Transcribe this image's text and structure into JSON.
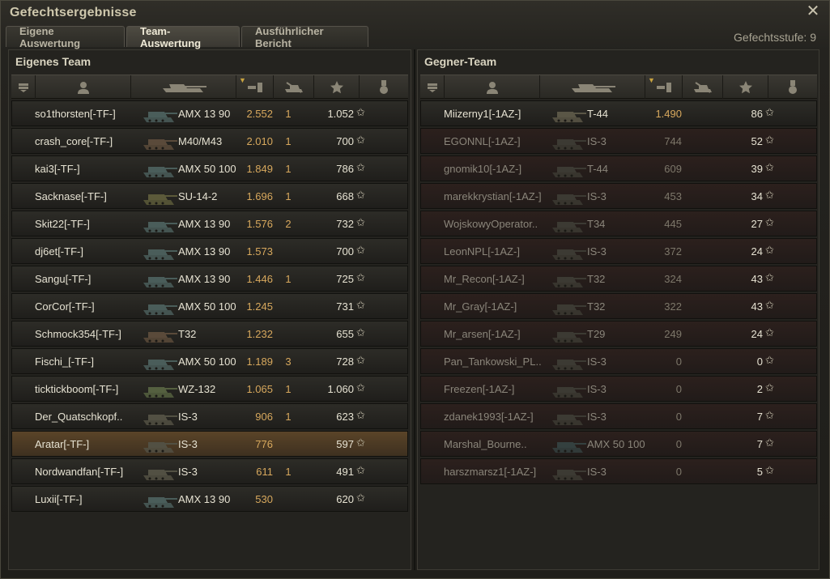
{
  "window": {
    "title": "Gefechtsergebnisse",
    "close_icon": "close-icon"
  },
  "tabs": [
    {
      "label": "Eigene Auswertung",
      "active": false
    },
    {
      "label": "Team-Auswertung",
      "active": true
    },
    {
      "label": "Ausführlicher Bericht",
      "active": false
    }
  ],
  "battle_tier": "Gefechtsstufe: 9",
  "colors": {
    "accent_orange": "#d7a85d",
    "dead_row": "#2c201d",
    "highlight_row": "#5a4428"
  },
  "columns": {
    "icons": [
      "squad-icon",
      "player-icon",
      "tank-icon",
      "damage-icon",
      "kills-icon",
      "xp-icon",
      "medal-icon"
    ],
    "sorted_by": "damage"
  },
  "own_team": {
    "title": "Eigenes Team",
    "players": [
      {
        "name": "so1thorsten[-TF-]",
        "vehicle": "AMX 13 90",
        "damage": "2.552",
        "kills": "1",
        "xp": "1.052",
        "tank_color": "#4a5d5a",
        "dead": false
      },
      {
        "name": "crash_core[-TF-]",
        "vehicle": "M40/M43",
        "damage": "2.010",
        "kills": "1",
        "xp": "700",
        "tank_color": "#5a4a3a",
        "dead": false
      },
      {
        "name": "kai3[-TF-]",
        "vehicle": "AMX 50 100",
        "damage": "1.849",
        "kills": "1",
        "xp": "786",
        "tank_color": "#4a5d5a",
        "dead": false
      },
      {
        "name": "Sacknase[-TF-]",
        "vehicle": "SU-14-2",
        "damage": "1.696",
        "kills": "1",
        "xp": "668",
        "tank_color": "#5c5a3a",
        "dead": false
      },
      {
        "name": "Skit22[-TF-]",
        "vehicle": "AMX 13 90",
        "damage": "1.576",
        "kills": "2",
        "xp": "732",
        "tank_color": "#4a5d5a",
        "dead": false
      },
      {
        "name": "dj6et[-TF-]",
        "vehicle": "AMX 13 90",
        "damage": "1.573",
        "kills": "",
        "xp": "700",
        "tank_color": "#4a5d5a",
        "dead": false
      },
      {
        "name": "Sangu[-TF-]",
        "vehicle": "AMX 13 90",
        "damage": "1.446",
        "kills": "1",
        "xp": "725",
        "tank_color": "#4a5d5a",
        "dead": false
      },
      {
        "name": "CorCor[-TF-]",
        "vehicle": "AMX 50 100",
        "damage": "1.245",
        "kills": "",
        "xp": "731",
        "tank_color": "#4a5d5a",
        "dead": false
      },
      {
        "name": "Schmock354[-TF-]",
        "vehicle": "T32",
        "damage": "1.232",
        "kills": "",
        "xp": "655",
        "tank_color": "#5a4a3a",
        "dead": false
      },
      {
        "name": "Fischi_[-TF-]",
        "vehicle": "AMX 50 100",
        "damage": "1.189",
        "kills": "3",
        "xp": "728",
        "tank_color": "#4a5d5a",
        "dead": false
      },
      {
        "name": "ticktickboom[-TF-]",
        "vehicle": "WZ-132",
        "damage": "1.065",
        "kills": "1",
        "xp": "1.060",
        "tank_color": "#556040",
        "dead": false
      },
      {
        "name": "Der_Quatschkopf..",
        "vehicle": "IS-3",
        "damage": "906",
        "kills": "1",
        "xp": "623",
        "tank_color": "#525043",
        "dead": false
      },
      {
        "name": "Aratar[-TF-]",
        "vehicle": "IS-3",
        "damage": "776",
        "kills": "",
        "xp": "597",
        "tank_color": "#525043",
        "dead": false,
        "highlight": true
      },
      {
        "name": "Nordwandfan[-TF-]",
        "vehicle": "IS-3",
        "damage": "611",
        "kills": "1",
        "xp": "491",
        "tank_color": "#525043",
        "dead": false
      },
      {
        "name": "Luxii[-TF-]",
        "vehicle": "AMX 13 90",
        "damage": "530",
        "kills": "",
        "xp": "620",
        "tank_color": "#4a5d5a",
        "dead": false
      }
    ]
  },
  "enemy_team": {
    "title": "Gegner-Team",
    "players": [
      {
        "name": "Miizerny1[-1AZ-]",
        "vehicle": "T-44",
        "damage": "1.490",
        "kills": "",
        "xp": "86",
        "tank_color": "#5a5646",
        "dead": false
      },
      {
        "name": "EGONNL[-1AZ-]",
        "vehicle": "IS-3",
        "damage": "744",
        "kills": "",
        "xp": "52",
        "tank_color": "#3c3a33",
        "dead": true
      },
      {
        "name": "gnomik10[-1AZ-]",
        "vehicle": "T-44",
        "damage": "609",
        "kills": "",
        "xp": "39",
        "tank_color": "#3c3a33",
        "dead": true
      },
      {
        "name": "marekkrystian[-1AZ-]",
        "vehicle": "IS-3",
        "damage": "453",
        "kills": "",
        "xp": "34",
        "tank_color": "#3c3a33",
        "dead": true
      },
      {
        "name": "WojskowyOperator..",
        "vehicle": "T34",
        "damage": "445",
        "kills": "",
        "xp": "27",
        "tank_color": "#3c3a33",
        "dead": true
      },
      {
        "name": "LeonNPL[-1AZ-]",
        "vehicle": "IS-3",
        "damage": "372",
        "kills": "",
        "xp": "24",
        "tank_color": "#3c3a33",
        "dead": true
      },
      {
        "name": "Mr_Recon[-1AZ-]",
        "vehicle": "T32",
        "damage": "324",
        "kills": "",
        "xp": "43",
        "tank_color": "#3c3a33",
        "dead": true
      },
      {
        "name": "Mr_Gray[-1AZ-]",
        "vehicle": "T32",
        "damage": "322",
        "kills": "",
        "xp": "43",
        "tank_color": "#3c3a33",
        "dead": true
      },
      {
        "name": "Mr_arsen[-1AZ-]",
        "vehicle": "T29",
        "damage": "249",
        "kills": "",
        "xp": "24",
        "tank_color": "#3c3a33",
        "dead": true
      },
      {
        "name": "Pan_Tankowski_PL..",
        "vehicle": "IS-3",
        "damage": "0",
        "kills": "",
        "xp": "0",
        "tank_color": "#3c3a33",
        "dead": true
      },
      {
        "name": "Freezen[-1AZ-]",
        "vehicle": "IS-3",
        "damage": "0",
        "kills": "",
        "xp": "2",
        "tank_color": "#3c3a33",
        "dead": true
      },
      {
        "name": "zdanek1993[-1AZ-]",
        "vehicle": "IS-3",
        "damage": "0",
        "kills": "",
        "xp": "7",
        "tank_color": "#3c3a33",
        "dead": true
      },
      {
        "name": "Marshal_Bourne..",
        "vehicle": "AMX 50 100",
        "damage": "0",
        "kills": "",
        "xp": "7",
        "tank_color": "#34403f",
        "dead": true
      },
      {
        "name": "harszmarsz1[-1AZ-]",
        "vehicle": "IS-3",
        "damage": "0",
        "kills": "",
        "xp": "5",
        "tank_color": "#3c3a33",
        "dead": true
      }
    ]
  }
}
